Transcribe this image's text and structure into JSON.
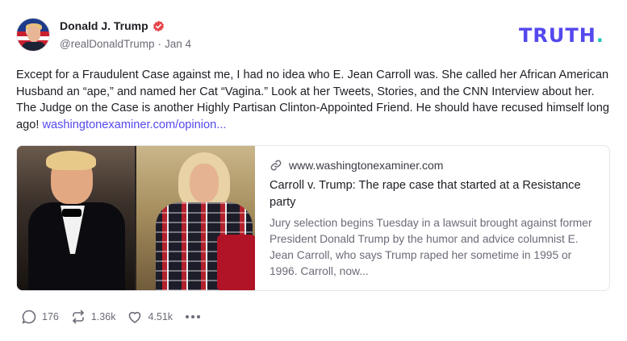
{
  "author": {
    "display_name": "Donald J. Trump",
    "handle": "@realDonaldTrump",
    "separator": "·",
    "date": "Jan 4",
    "verified_icon": "verified-badge-icon",
    "verified_color": "#e5484d"
  },
  "brand": {
    "logo_text": "TRUTH",
    "logo_dot": ".",
    "logo_color": "#5448ee",
    "dot_color": "#26c6b4"
  },
  "post": {
    "text": "Except for a Fraudulent Case against me, I had no idea who E. Jean Carroll was. She called her African American Husband an “ape,” and named her Cat “Vagina.” Look at her Tweets, Stories, and the CNN Interview about her. The Judge on the Case is another Highly Partisan Clinton-Appointed Friend. He should have recused himself long ago!",
    "link_text": "washingtonexaminer.com/opinion...",
    "link_color": "#5448ee"
  },
  "link_card": {
    "domain": "www.washingtonexaminer.com",
    "domain_icon": "link-icon",
    "title": "Carroll v. Trump: The rape case that started at a Resistance party",
    "description": "Jury selection begins Tuesday in a lawsuit brought against former President Donald Trump by the humor and advice columnist E. Jean Carroll, who says Trump raped her sometime in 1995 or 1996. Carroll, now..."
  },
  "actions": {
    "reply": {
      "icon": "reply-icon",
      "count": "176"
    },
    "retruth": {
      "icon": "retruth-icon",
      "count": "1.36k"
    },
    "like": {
      "icon": "heart-icon",
      "count": "4.51k"
    },
    "more": {
      "icon": "more-icon"
    }
  }
}
